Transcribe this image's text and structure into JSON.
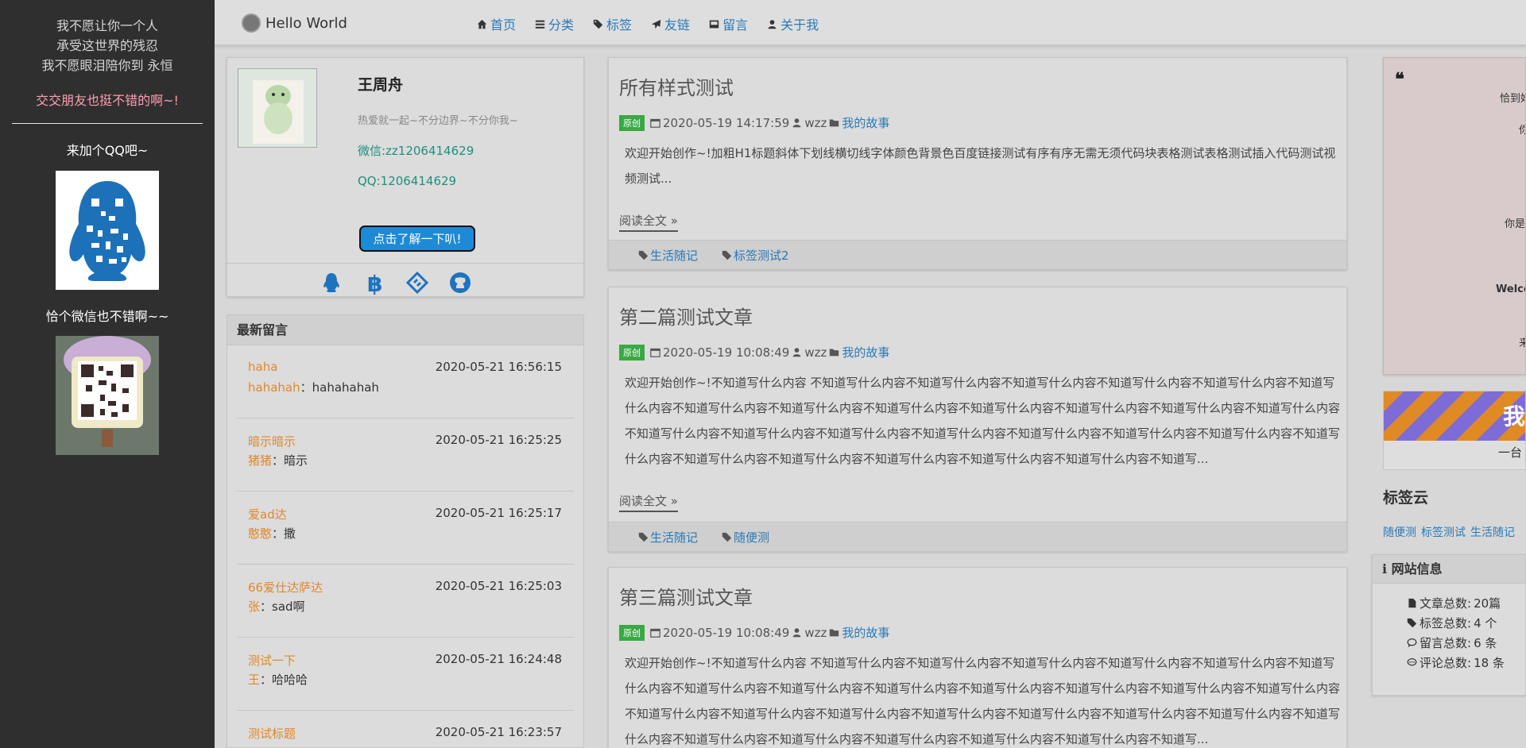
{
  "leftbar": {
    "poem": [
      "我不愿让你一个人",
      "承受这世界的残忍",
      "我不愿眼泪陪你到 永恒"
    ],
    "friend_text": "交交朋友也挺不错的啊~!",
    "qq_title": "来加个QQ吧~",
    "wechat_title": "恰个微信也不错啊~~"
  },
  "nav": {
    "brand": "Hello World",
    "items": [
      {
        "label": "首页",
        "icon": "home-icon"
      },
      {
        "label": "分类",
        "icon": "list-icon"
      },
      {
        "label": "标签",
        "icon": "tags-icon"
      },
      {
        "label": "友链",
        "icon": "paper-plane-icon"
      },
      {
        "label": "留言",
        "icon": "inbox-icon"
      },
      {
        "label": "关于我",
        "icon": "user-icon"
      }
    ]
  },
  "profile": {
    "name": "王周舟",
    "motto": "热爱就一起~不分边界~不分你我~",
    "wechat": "微信:zz1206414629",
    "qq": "QQ:1206414629",
    "button": "点击了解一下叭!",
    "social_icons": [
      "qq-icon",
      "bitcoin-icon",
      "code-icon",
      "github-icon"
    ]
  },
  "messages": {
    "title": "最新留言",
    "items": [
      {
        "name": "haha",
        "time": "2020-05-21 16:56:15",
        "who": "hahahah",
        "content": "hahahahah"
      },
      {
        "name": "暗示暗示",
        "time": "2020-05-21 16:25:25",
        "who": "猪猪",
        "content": "暗示"
      },
      {
        "name": "爱ad达",
        "time": "2020-05-21 16:25:17",
        "who": "憨憨",
        "content": "撒"
      },
      {
        "name": "66爱仕达萨达",
        "time": "2020-05-21 16:25:03",
        "who": "张",
        "content": "sad啊"
      },
      {
        "name": "测试一下",
        "time": "2020-05-21 16:24:48",
        "who": "王",
        "content": "哈哈哈"
      },
      {
        "name": "测试标题",
        "time": "2020-05-21 16:23:57",
        "who": "",
        "content": ""
      }
    ]
  },
  "articles": [
    {
      "title": "所有样式测试",
      "badge": "原创",
      "date": "2020-05-19 14:17:59",
      "author": "wzz",
      "category": "我的故事",
      "excerpt": "欢迎开始创作~!加粗H1标题斜体下划线横切线字体颜色背景色百度链接测试有序有序无需无须代码块表格测试表格测试插入代码测试视频测试...",
      "read_more": "阅读全文 »",
      "tags": [
        "生活随记",
        "标签测试2"
      ]
    },
    {
      "title": "第二篇测试文章",
      "badge": "原创",
      "date": "2020-05-19 10:08:49",
      "author": "wzz",
      "category": "我的故事",
      "excerpt": "欢迎开始创作~!不知道写什么内容 不知道写什么内容不知道写什么内容不知道写什么内容不知道写什么内容不知道写什么内容不知道写什么内容不知道写什么内容不知道写什么内容不知道写什么内容不知道写什么内容不知道写什么内容不知道写什么内容不知道写什么内容不知道写什么内容不知道写什么内容不知道写什么内容不知道写什么内容不知道写什么内容不知道写什么内容不知道写什么内容不知道写什么内容不知道写什么内容不知道写什么内容不知道写什么内容不知道写什么内容不知道写什么内容不知道写...",
      "read_more": "阅读全文 »",
      "tags": [
        "生活随记",
        "随便测"
      ]
    },
    {
      "title": "第三篇测试文章",
      "badge": "原创",
      "date": "2020-05-19 10:08:49",
      "author": "wzz",
      "category": "我的故事",
      "excerpt": "欢迎开始创作~!不知道写什么内容 不知道写什么内容不知道写什么内容不知道写什么内容不知道写什么内容不知道写什么内容不知道写什么内容不知道写什么内容不知道写什么内容不知道写什么内容不知道写什么内容不知道写什么内容不知道写什么内容不知道写什么内容不知道写什么内容不知道写什么内容不知道写什么内容不知道写什么内容不知道写什么内容不知道写什么内容不知道写什么内容不知道写什么内容不知道写什么内容不知道写什么内容不知道写什么内容不知道写什么内容不知道写什么内容不知道写..."
    }
  ],
  "quote": {
    "lines": [
      "恰到好",
      "你",
      "你是",
      "Welco",
      "来"
    ]
  },
  "stripe": {
    "title": "我",
    "subtitle": "一台"
  },
  "tagcloud": {
    "title": "标签云",
    "tags": [
      "随便测",
      "标签测试",
      "生活随记"
    ]
  },
  "siteinfo": {
    "title": "网站信息",
    "rows": [
      {
        "label": "文章总数:",
        "value": "20篇",
        "icon": "file-icon"
      },
      {
        "label": "标签总数:",
        "value": "4 个",
        "icon": "tags-icon"
      },
      {
        "label": "留言总数:",
        "value": "6 条",
        "icon": "comments-icon"
      },
      {
        "label": "评论总数:",
        "value": "18 条",
        "icon": "comment-icon"
      }
    ]
  }
}
